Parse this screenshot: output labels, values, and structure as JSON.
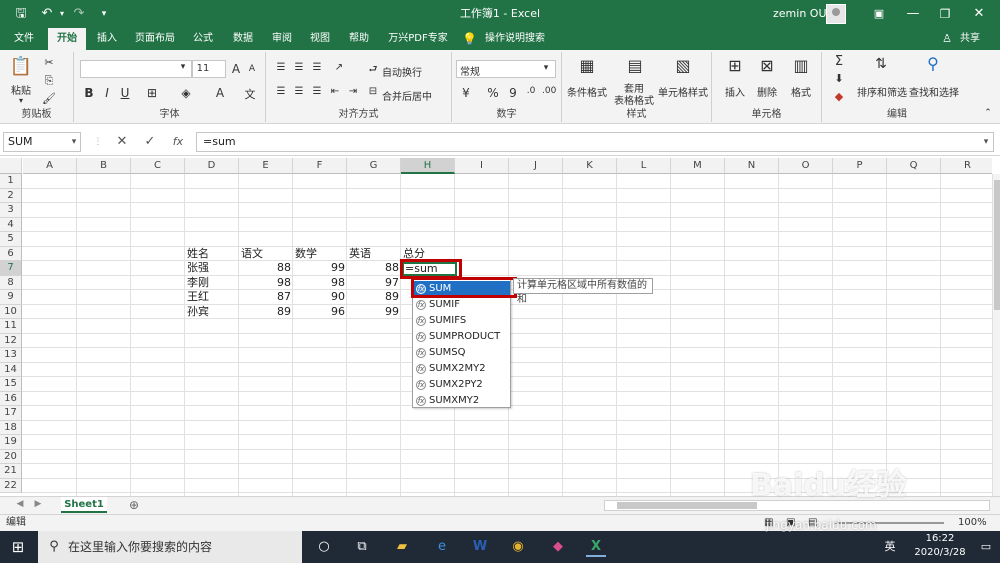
{
  "titlebar": {
    "title": "工作簿1  -  Excel",
    "user": "zemin OU",
    "save_icon": "save-icon",
    "undo_icon": "undo-icon",
    "redo_icon": "redo-icon",
    "customize_icon": "customize-icon",
    "ribbon_display_icon": "ribbon-display-icon",
    "minimize_icon": "minimize-icon",
    "maximize_icon": "maximize-icon",
    "close_icon": "close-icon"
  },
  "menubar": {
    "tabs": [
      "文件",
      "开始",
      "插入",
      "页面布局",
      "公式",
      "数据",
      "审阅",
      "视图",
      "帮助",
      "万兴PDF专家",
      "操作说明搜索"
    ],
    "active": "开始",
    "share": "共享"
  },
  "ribbon": {
    "clipboard": {
      "paste": "粘贴",
      "label": "剪贴板"
    },
    "font": {
      "size": "11",
      "bold": "B",
      "italic": "I",
      "underline": "U",
      "label": "字体",
      "grow": "A",
      "shrink": "A"
    },
    "alignment": {
      "wrap": "自动换行",
      "merge": "合并后居中",
      "label": "对齐方式"
    },
    "number": {
      "format": "常规",
      "percent": "%",
      "comma": "9",
      "label": "数字"
    },
    "styles": {
      "cond": "条件格式",
      "table": "套用\n表格格式",
      "cell": "单元格样式",
      "label": "样式"
    },
    "cells": {
      "insert": "插入",
      "delete": "删除",
      "format": "格式",
      "label": "单元格"
    },
    "editing": {
      "sort": "排序和筛选",
      "find": "查找和选择",
      "label": "编辑"
    }
  },
  "formula_bar": {
    "name_box": "SUM",
    "cancel": "✕",
    "enter": "✓",
    "fx": "fx",
    "formula": "=sum"
  },
  "grid": {
    "columns": [
      "A",
      "B",
      "C",
      "D",
      "E",
      "F",
      "G",
      "H",
      "I",
      "J",
      "K",
      "L",
      "M",
      "N",
      "O",
      "P",
      "Q",
      "R"
    ],
    "rows": [
      "1",
      "2",
      "3",
      "4",
      "5",
      "6",
      "7",
      "8",
      "9",
      "10",
      "11",
      "12",
      "13",
      "14",
      "15",
      "16",
      "17",
      "18",
      "19",
      "20",
      "21",
      "22"
    ],
    "headers": [
      "姓名",
      "语文",
      "数学",
      "英语",
      "总分"
    ],
    "records": [
      {
        "name": "张强",
        "chinese": "88",
        "math": "99",
        "english": "88"
      },
      {
        "name": "李刚",
        "chinese": "98",
        "math": "98",
        "english": "97"
      },
      {
        "name": "王红",
        "chinese": "87",
        "math": "90",
        "english": "89"
      },
      {
        "name": "孙宾",
        "chinese": "89",
        "math": "96",
        "english": "99"
      }
    ],
    "active_cell_value": "=sum"
  },
  "autocomplete": {
    "items": [
      "SUM",
      "SUMIF",
      "SUMIFS",
      "SUMPRODUCT",
      "SUMSQ",
      "SUMX2MY2",
      "SUMX2PY2",
      "SUMXMY2"
    ],
    "selected": "SUM",
    "tooltip": "计算单元格区域中所有数值的和"
  },
  "sheets": {
    "tabs": [
      "Sheet1"
    ],
    "add": "⊕"
  },
  "status": {
    "mode": "编辑",
    "zoom": "100%"
  },
  "taskbar": {
    "search_placeholder": "在这里输入你要搜索的内容",
    "ime": "英",
    "time": "16:22",
    "date": "2020/3/28"
  },
  "watermark": {
    "logo": "Baidu经验",
    "url": "jingyan.baidu.com"
  },
  "colors": {
    "excel_green": "#217346",
    "highlight_red": "#c00000",
    "selection_blue": "#1f6fc5"
  }
}
